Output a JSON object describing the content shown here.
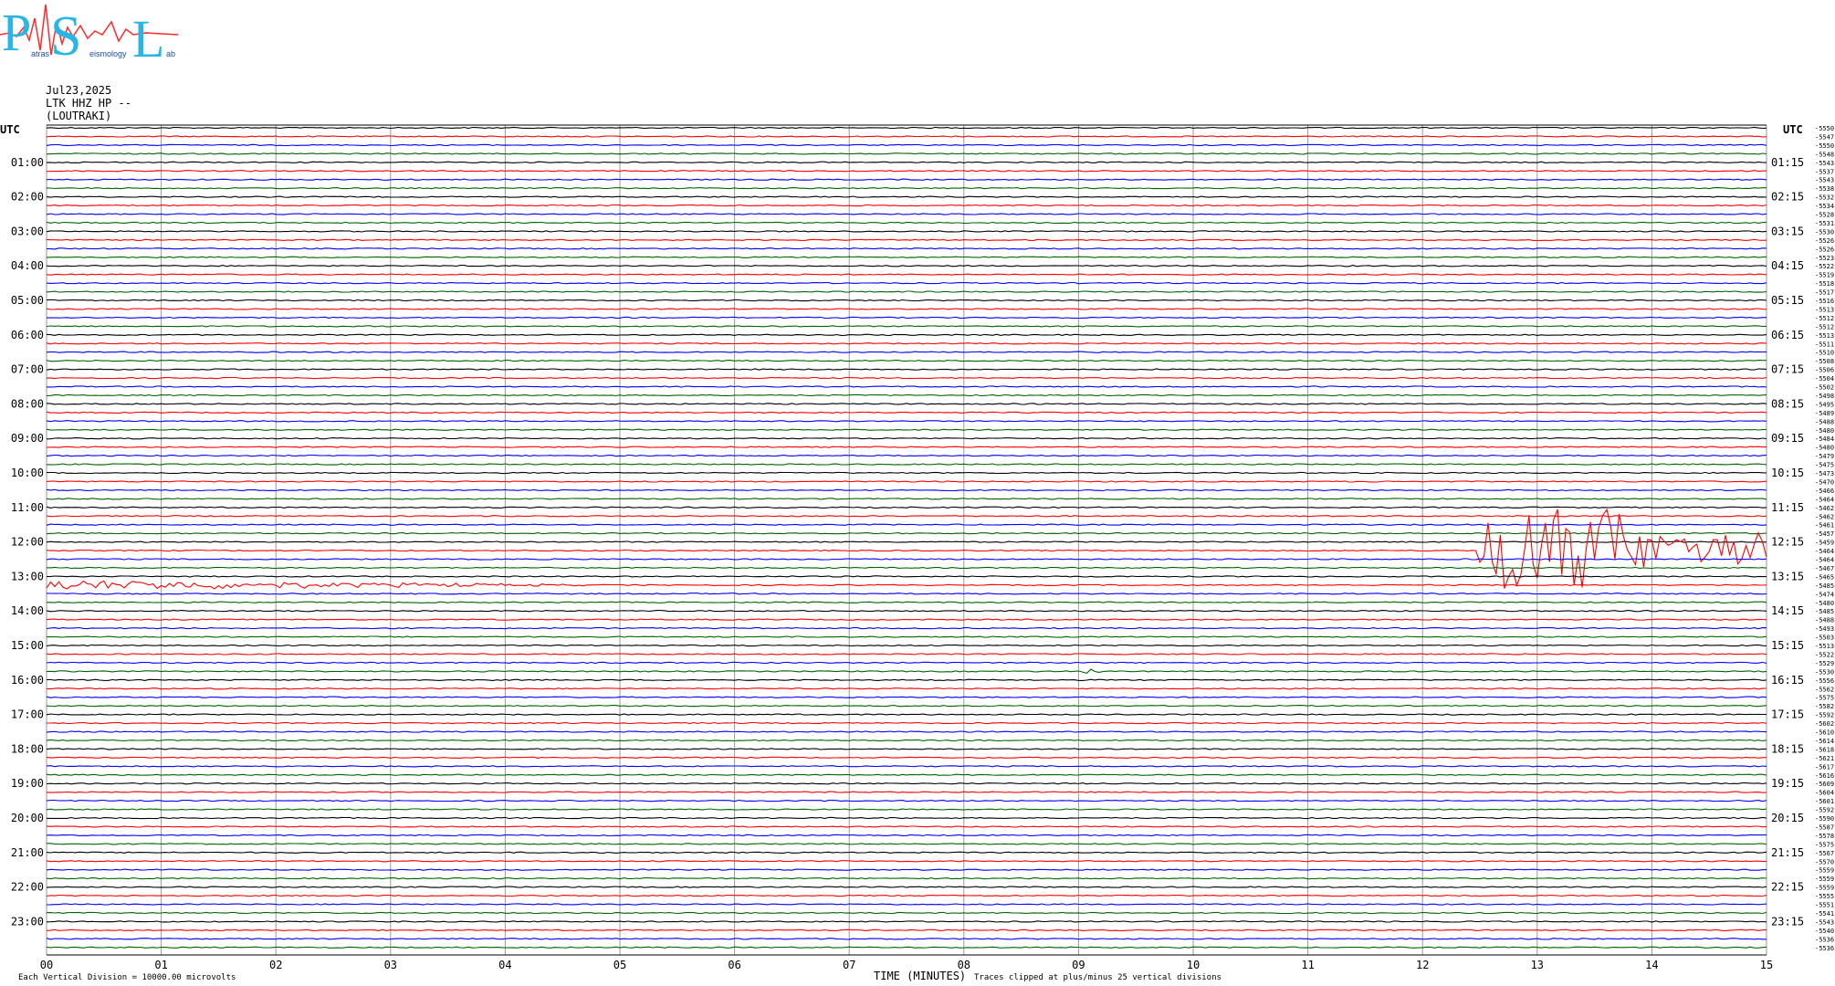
{
  "logo": {
    "letters": [
      "P",
      "S",
      "L"
    ],
    "small_words": [
      "atras",
      "eismology",
      "ab"
    ],
    "colors": {
      "letters": "#29b6e6",
      "trace": "#ff2a2a"
    }
  },
  "header": {
    "date": "Jul23,2025",
    "station": "LTK HHZ HP --",
    "location": "(LOUTRAKI)"
  },
  "chart_data": {
    "type": "helicorder",
    "left_label": "UTC",
    "right_label": "UTC",
    "xlabel": "TIME (MINUTES)",
    "x_ticks": [
      "00",
      "01",
      "02",
      "03",
      "04",
      "05",
      "06",
      "07",
      "08",
      "09",
      "10",
      "11",
      "12",
      "13",
      "14",
      "15"
    ],
    "left_hours": [
      "01:00",
      "02:00",
      "03:00",
      "04:00",
      "05:00",
      "06:00",
      "07:00",
      "08:00",
      "09:00",
      "10:00",
      "11:00",
      "12:00",
      "13:00",
      "14:00",
      "15:00",
      "16:00",
      "17:00",
      "18:00",
      "19:00",
      "20:00",
      "21:00",
      "22:00",
      "23:00"
    ],
    "right_hours": [
      "01:15",
      "02:15",
      "03:15",
      "04:15",
      "05:15",
      "06:15",
      "07:15",
      "08:15",
      "09:15",
      "10:15",
      "11:15",
      "12:15",
      "13:15",
      "14:15",
      "15:15",
      "16:15",
      "17:15",
      "18:15",
      "19:15",
      "20:15",
      "21:15",
      "22:15",
      "23:15"
    ],
    "line_count": 96,
    "line_colors": [
      "#000000",
      "#ff0000",
      "#0000ff",
      "#006400"
    ],
    "offsets": [
      "-5550",
      "-5547",
      "-5550",
      "-5548",
      "-5543",
      "-5537",
      "-5543",
      "-5538",
      "-5532",
      "-5534",
      "-5528",
      "-5531",
      "-5530",
      "-5526",
      "-5526",
      "-5523",
      "-5522",
      "-5519",
      "-5518",
      "-5517",
      "-5516",
      "-5513",
      "-5512",
      "-5512",
      "-5513",
      "-5511",
      "-5510",
      "-5508",
      "-5506",
      "-5504",
      "-5502",
      "-5498",
      "-5495",
      "-5489",
      "-5488",
      "-5480",
      "-5484",
      "-5480",
      "-5479",
      "-5475",
      "-5473",
      "-5470",
      "-5466",
      "-5464",
      "-5462",
      "-5462",
      "-5461",
      "-5457",
      "-5459",
      "-5464",
      "-5464",
      "-5467",
      "-5465",
      "-5485",
      "-5474",
      "-5480",
      "-5485",
      "-5488",
      "-5493",
      "-5503",
      "-5513",
      "-5522",
      "-5529",
      "-5530",
      "-5556",
      "-5562",
      "-5575",
      "-5582",
      "-5592",
      "-5602",
      "-5610",
      "-5614",
      "-5618",
      "-5621",
      "-5617",
      "-5616",
      "-5609",
      "-5604",
      "-5601",
      "-5592",
      "-5590",
      "-5587",
      "-5578",
      "-5575",
      "-5567",
      "-5570",
      "-5559",
      "-5559",
      "-5559",
      "-5555",
      "-5551",
      "-5541",
      "-5543",
      "-5540",
      "-5536",
      "-5536"
    ],
    "footer_left": "Each Vertical Division = 10000.00 microvolts",
    "footer_right": "Traces clipped at plus/minus 25 vertical divisions",
    "events": [
      {
        "line": 53,
        "start_min": 0.0,
        "end_min": 5.0,
        "amplitude": 0.6,
        "type": "teleseism onset"
      },
      {
        "line": 49,
        "start_min": 12.5,
        "end_min": 15.0,
        "amplitude": 5.0,
        "type": "local event"
      },
      {
        "line": 63,
        "start_min": 9.0,
        "end_min": 9.3,
        "amplitude": 0.5,
        "type": "small event"
      }
    ]
  }
}
